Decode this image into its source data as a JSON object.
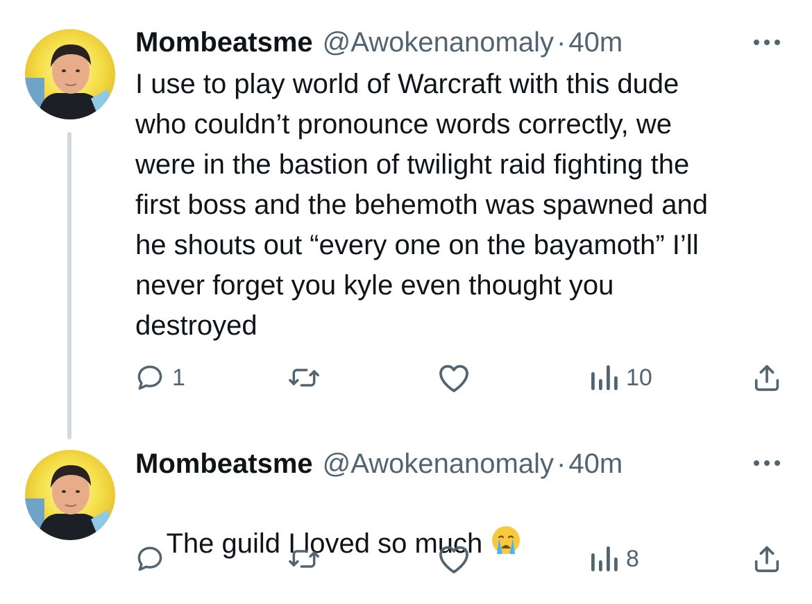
{
  "tweets": [
    {
      "author_name": "Mombeatsme",
      "handle": "@Awokenanomaly",
      "separator": "·",
      "time": "40m",
      "text": "I use to play world of Warcraft with this dude\nwho couldn’t pronounce words correctly, we\nwere in the bastion of twilight raid fighting the\nfirst boss and the behemoth was spawned and\nhe shouts out “every one on the bayamoth” I’ll\nnever forget you kyle even thought you\ndestroyed",
      "reply_count": "1",
      "retweet_count": "",
      "like_count": "",
      "view_count": "10",
      "icons": [
        "reply-icon",
        "retweet-icon",
        "like-icon",
        "views-icon",
        "share-icon",
        "more-icon"
      ]
    },
    {
      "author_name": "Mombeatsme",
      "handle": "@Awokenanomaly",
      "separator": "·",
      "time": "40m",
      "text": "The guild I loved so much",
      "emoji": "loudly-crying-face",
      "reply_count": "",
      "retweet_count": "",
      "like_count": "",
      "view_count": "8",
      "icons": [
        "reply-icon",
        "retweet-icon",
        "like-icon",
        "views-icon",
        "share-icon",
        "more-icon"
      ]
    }
  ],
  "colors": {
    "text": "#0f1419",
    "secondary": "#536471",
    "thread_line": "#cfd9de",
    "avatar_ring": "#f5e04a"
  }
}
